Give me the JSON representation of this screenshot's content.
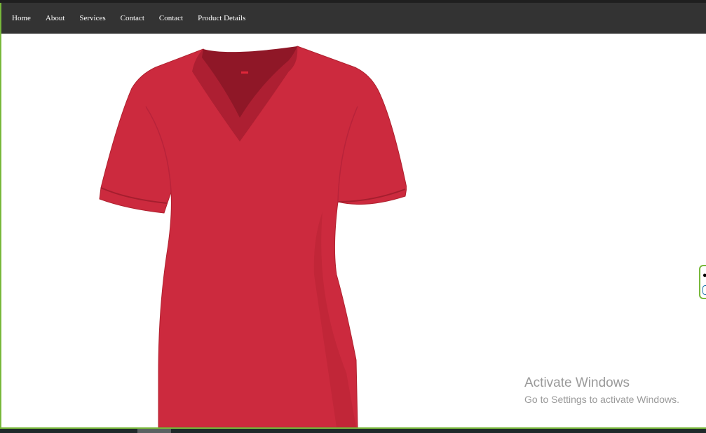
{
  "nav": {
    "items": [
      {
        "label": "Home"
      },
      {
        "label": "About"
      },
      {
        "label": "Services"
      },
      {
        "label": "Contact"
      },
      {
        "label": "Contact"
      },
      {
        "label": "Product Details"
      }
    ]
  },
  "product": {
    "image": "red-vneck-tshirt",
    "color": "#cc2a3e"
  },
  "colors": {
    "navbar": "#333333",
    "accent_border": "#78b83b"
  },
  "watermark": {
    "title": "Activate Windows",
    "subtitle": "Go to Settings to activate Windows."
  }
}
